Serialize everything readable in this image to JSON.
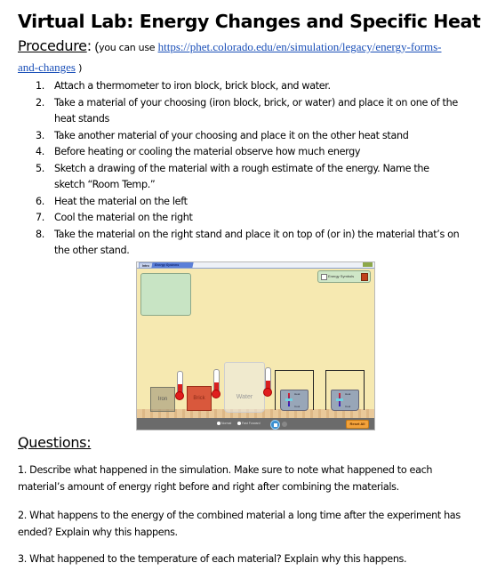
{
  "document": {
    "title": "Virtual Lab: Energy Changes and Specific Heat",
    "procedure": {
      "heading": "Procedure",
      "colon": ":",
      "open_paren": "(",
      "intro": "you can use",
      "link_text_1": "https://phet.colorado.edu/en/simulation/legacy/energy-forms-",
      "link_text_2": "and-changes",
      "close_paren": " )"
    },
    "steps": [
      {
        "num": "1.",
        "text": "Attach a thermometer to iron block, brick block, and water."
      },
      {
        "num": "2.",
        "text": "Take a material of your choosing (iron block, brick, or water) and place it on one of the heat stands"
      },
      {
        "num": "3.",
        "text": "Take another material of your choosing and place it on the other heat stand"
      },
      {
        "num": "4.",
        "text": "Before heating or cooling the material observe how much energy"
      },
      {
        "num": "5.",
        "text": "Sketch a drawing of the material with a rough estimate of the energy. Name the sketch “Room Temp.”"
      },
      {
        "num": "6.",
        "text": "Heat the material on the left"
      },
      {
        "num": "7.",
        "text": "Cool the material on the right"
      },
      {
        "num": "8.",
        "text": "Take the material on the right stand and place it on top of (or in) the material that’s on the other stand."
      }
    ],
    "simulation": {
      "tabs": [
        "Intro",
        "Energy Systems"
      ],
      "energy_symbols_label": "Energy Symbols",
      "energy_symbols_checked": true,
      "blocks": [
        "Iron",
        "Brick"
      ],
      "beaker_label": "Water",
      "burners": [
        {
          "heat_label": "Heat",
          "cool_label": "Cool"
        },
        {
          "heat_label": "Heat",
          "cool_label": "Cool"
        }
      ],
      "speed_options": [
        "Normal",
        "Fast Forward"
      ],
      "reset_label": "Reset All",
      "colors": {
        "background": "#f6e9b1",
        "reset_button": "#f3a23b",
        "control_bar": "#6b6b6b"
      }
    },
    "questions": {
      "heading": "Questions:",
      "items": [
        "1. Describe what happened in the simulation. Make sure to note what happened to each material’s amount of energy right before and right after combining the materials.",
        "2. What happens to the energy of the combined material a long time after the experiment has ended? Explain why this happens.",
        "3. What happened to the temperature of each material? Explain why this happens."
      ]
    },
    "link_color": "#1a4fb8"
  }
}
